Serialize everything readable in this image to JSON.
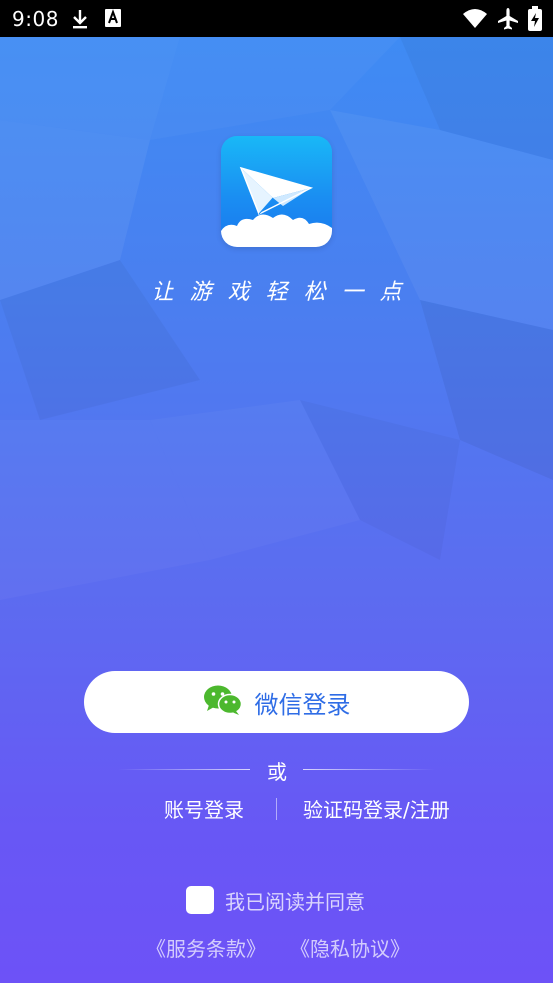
{
  "status_bar": {
    "time": "9:08",
    "icons": [
      "download-icon",
      "font-a-icon",
      "wifi-icon",
      "airplane-icon",
      "battery-icon"
    ]
  },
  "app": {
    "logo_icon": "paper-plane-cloud-icon",
    "slogan": "让游戏轻松一点"
  },
  "login": {
    "wechat_label": "微信登录",
    "wechat_icon": "wechat-icon",
    "or_text": "或",
    "account_login": "账号登录",
    "code_login": "验证码登录/注册"
  },
  "agreement": {
    "agree_text": "我已阅读并同意",
    "terms_link": "《服务条款》",
    "privacy_link": "《隐私协议》"
  },
  "colors": {
    "background_top": "#3d8df4",
    "background_bottom": "#6d52f7",
    "wechat_green": "#4cb82e",
    "button_text": "#2f6de6"
  }
}
